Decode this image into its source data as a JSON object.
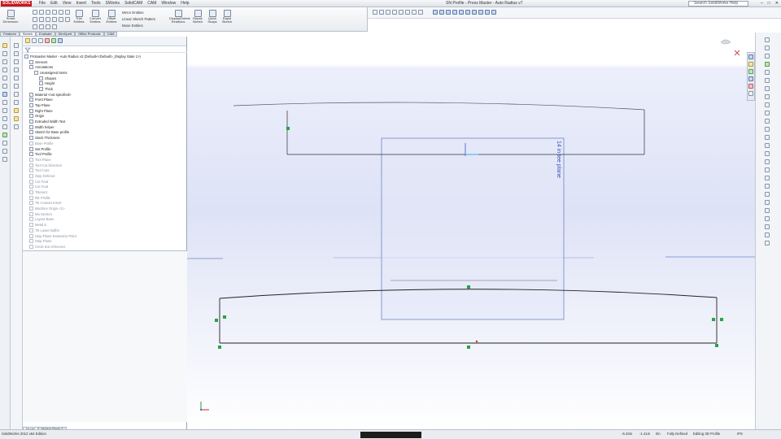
{
  "app": {
    "logo": "SOLIDWORKS",
    "title": "SN Profile - Press Master - Auto Radius v7"
  },
  "menu": [
    "File",
    "Edit",
    "View",
    "Insert",
    "Tools",
    "SWorks",
    "SolidCAM",
    "CAM",
    "Window",
    "Help"
  ],
  "search": {
    "placeholder": "Search SolidWorks Help"
  },
  "window_buttons": [
    "–",
    "□",
    "✕"
  ],
  "toolbar": {
    "smart_dimension": "Smart Dimension",
    "trim_entities": "Trim Entities",
    "convert_entities": "Convert Entities",
    "offset_entities": "Offset Entities",
    "mirror_entities": "Mirror Entities",
    "linear_sketch_pattern": "Linear Sketch Pattern",
    "move_entities": "Move Entities",
    "display_delete_relations": "Display/Delete Relations",
    "repair_sketch": "Repair Sketch",
    "quick_snaps": "Quick Snaps",
    "rapid_sketch": "Rapid Sketch"
  },
  "panel_tabs": [
    "Features",
    "Sketch",
    "Evaluate",
    "DimXpert",
    "Office Products",
    "CAM"
  ],
  "active_panel_tab": "Sketch",
  "tree": [
    {
      "label": "Protoaster Master - Auto Radius v2 (Default<<Default>_Display State 1>)",
      "dim": false
    },
    {
      "label": "Sensors",
      "dim": false
    },
    {
      "label": "Annotations",
      "dim": false
    },
    {
      "label": "Unassigned Items",
      "dim": false
    },
    {
      "label": "Shapes",
      "dim": false
    },
    {
      "label": "Height",
      "dim": false
    },
    {
      "label": "Thick",
      "dim": false
    },
    {
      "label": "Material <not specified>",
      "dim": false
    },
    {
      "label": "Front Plane",
      "dim": false
    },
    {
      "label": "Top Plane",
      "dim": false
    },
    {
      "label": "Right Plane",
      "dim": false
    },
    {
      "label": "Origin",
      "dim": false
    },
    {
      "label": "Extruded Width Text",
      "dim": false
    },
    {
      "label": "Width helper",
      "dim": false
    },
    {
      "label": "Sketch for Base profile",
      "dim": false
    },
    {
      "label": "Stock Thickness",
      "dim": false
    },
    {
      "label": "Base Profile",
      "dim": true
    },
    {
      "label": "Set Profile",
      "dim": false
    },
    {
      "label": "Tool Profile",
      "dim": false
    },
    {
      "label": "Tool Plane",
      "dim": true
    },
    {
      "label": "Tool Cut Direction",
      "dim": true
    },
    {
      "label": "Tool Cuts",
      "dim": true
    },
    {
      "label": "Stop Defined",
      "dim": true
    },
    {
      "label": "Cut Feat",
      "dim": true
    },
    {
      "label": "Cut Feat",
      "dim": true
    },
    {
      "label": "Tolerant",
      "dim": true
    },
    {
      "label": "RE Profile",
      "dim": true
    },
    {
      "label": "TE Contact Insert",
      "dim": true
    },
    {
      "label": "Machine Origin <1>",
      "dim": true
    },
    {
      "label": "Ma Section",
      "dim": true
    },
    {
      "label": "Layout Base",
      "dim": true
    },
    {
      "label": "Metal E",
      "dim": true
    },
    {
      "label": "TE Lower Buffer",
      "dim": true
    },
    {
      "label": "Stop Plane Extension Point",
      "dim": true
    },
    {
      "label": "Stop Plane",
      "dim": true
    },
    {
      "label": "Circle text reference",
      "dim": true
    }
  ],
  "bottom_tabs": [
    "Model",
    "Motion Study 1"
  ],
  "viewport": {
    "plane_label": "14 in tee plane"
  },
  "status": {
    "edition": "SolidWorks 2012 x64 Edition",
    "x": "-6.33in",
    "y": "-1.41in",
    "z": "0in",
    "state": "Fully Defined",
    "editing": "Editing 3D Profile",
    "units": "IPS"
  }
}
